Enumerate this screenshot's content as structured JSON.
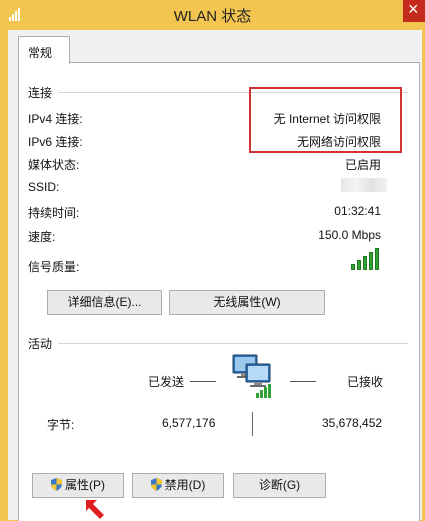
{
  "window": {
    "title": "WLAN 状态"
  },
  "tabs": [
    {
      "label": "常规"
    }
  ],
  "connection": {
    "section_label": "连接",
    "rows": [
      {
        "label": "IPv4 连接:",
        "value": "无 Internet 访问权限"
      },
      {
        "label": "IPv6 连接:",
        "value": "无网络访问权限"
      },
      {
        "label": "媒体状态:",
        "value": "已启用"
      },
      {
        "label": "SSID:",
        "value": ""
      },
      {
        "label": "持续时间:",
        "value": "01:32:41"
      },
      {
        "label": "速度:",
        "value": "150.0 Mbps"
      },
      {
        "label": "信号质量:",
        "value": ""
      }
    ],
    "signal_bars": 5,
    "details_button": "详细信息(E)...",
    "wireless_props_button": "无线属性(W)"
  },
  "activity": {
    "section_label": "活动",
    "sent_label": "已发送",
    "received_label": "已接收",
    "bytes_label": "字节:",
    "bytes_sent": "6,577,176",
    "bytes_received": "35,678,452"
  },
  "footer": {
    "properties_button": "属性(P)",
    "disable_button": "禁用(D)",
    "diagnose_button": "诊断(G)"
  },
  "colors": {
    "title_bar": "#f1c54f",
    "highlight_box": "#d23232",
    "arrow": "#e02020",
    "signal": "#32a032"
  }
}
